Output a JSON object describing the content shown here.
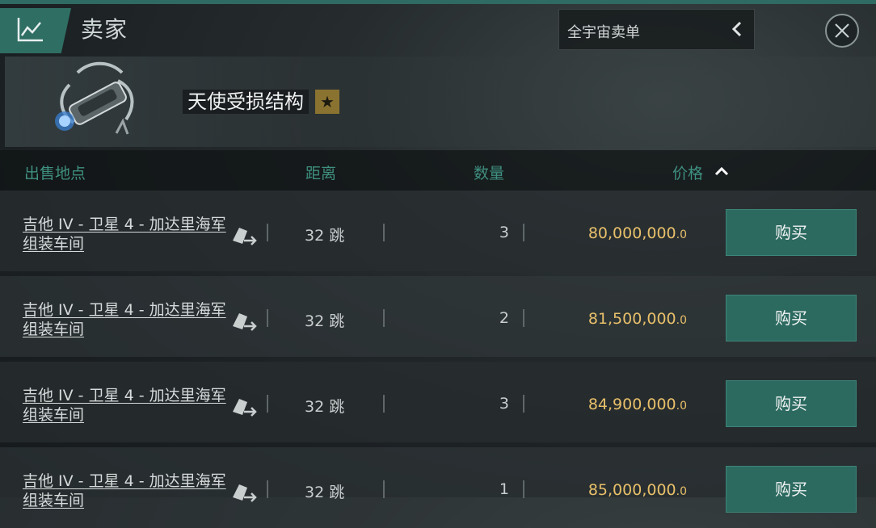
{
  "header": {
    "title": "卖家",
    "filter_label": "全宇宙卖单"
  },
  "item": {
    "name": "天使受损结构",
    "star": "★"
  },
  "columns": {
    "location": "出售地点",
    "distance": "距离",
    "quantity": "数量",
    "price": "价格",
    "price_sort": "ascending"
  },
  "rows": [
    {
      "location": "吉他 IV - 卫星 4 - 加达里海军 组装车间",
      "distance": "32 跳",
      "quantity": "3",
      "price_main": "80,000,000",
      "price_dec": ".0",
      "buy_label": "购买"
    },
    {
      "location": "吉他 IV - 卫星 4 - 加达里海军 组装车间",
      "distance": "32 跳",
      "quantity": "2",
      "price_main": "81,500,000",
      "price_dec": ".0",
      "buy_label": "购买"
    },
    {
      "location": "吉他 IV - 卫星 4 - 加达里海军 组装车间",
      "distance": "32 跳",
      "quantity": "3",
      "price_main": "84,900,000",
      "price_dec": ".0",
      "buy_label": "购买"
    },
    {
      "location": "吉他 IV - 卫星 4 - 加达里海军 组装车间",
      "distance": "32 跳",
      "quantity": "1",
      "price_main": "85,000,000",
      "price_dec": ".0",
      "buy_label": "购买"
    }
  ],
  "icons": {
    "header": "market-chart-icon",
    "filter": "chevron-left-icon",
    "close": "close-icon",
    "route": "set-destination-icon",
    "sort": "chevron-up-icon"
  },
  "colors": {
    "accent": "#2f6e63",
    "header_text": "#3f9080",
    "price": "#e8c06a",
    "star_badge": "#8a7330"
  }
}
